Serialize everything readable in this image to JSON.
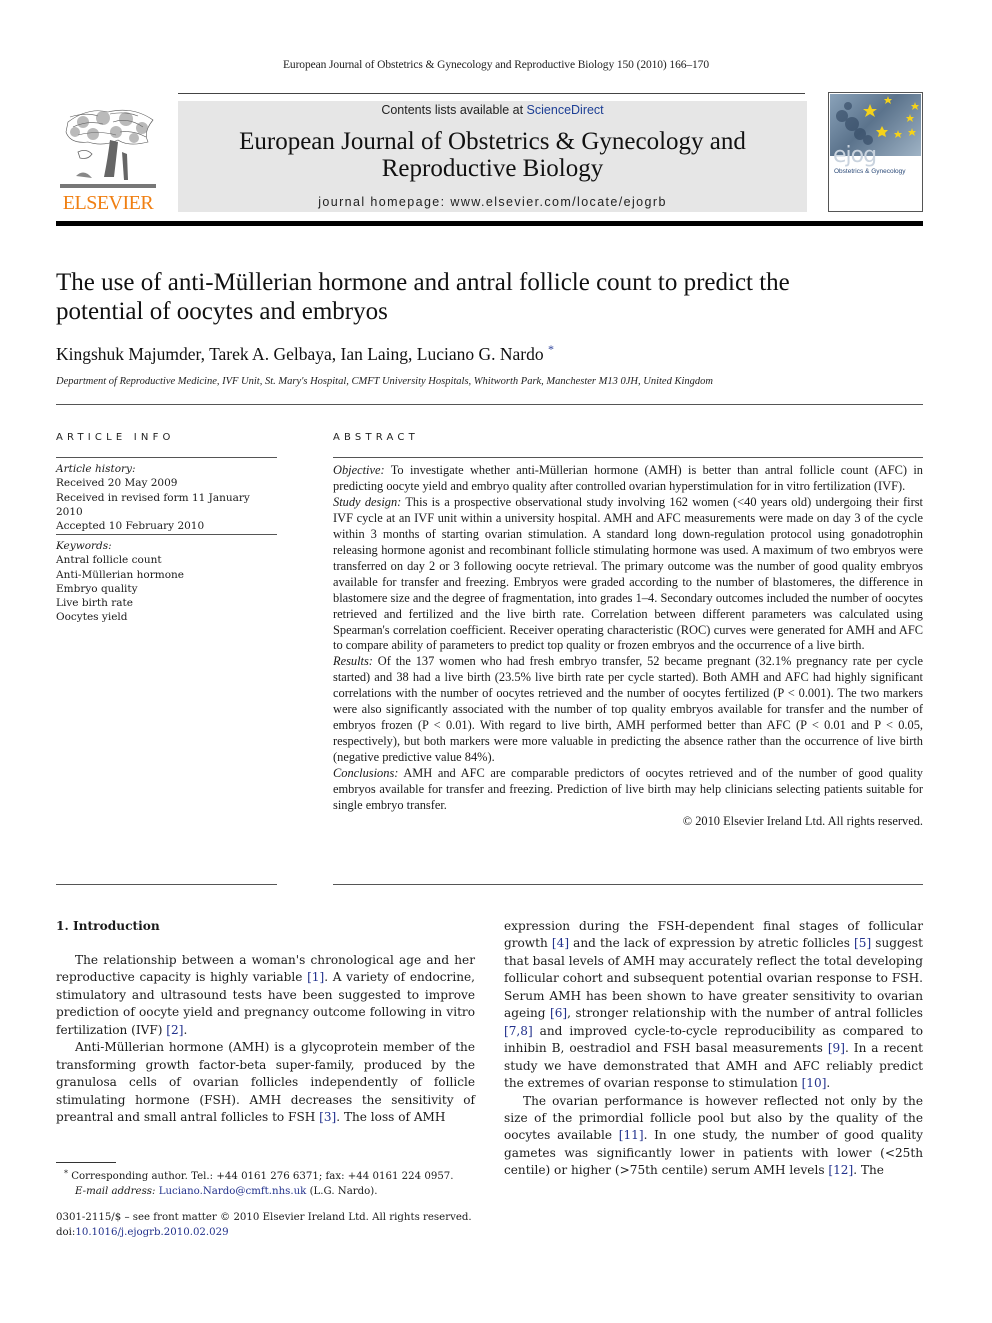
{
  "running_head": "European Journal of Obstetrics & Gynecology and Reproductive Biology 150 (2010) 166–170",
  "masthead": {
    "publisher_logo": "ELSEVIER",
    "contents_prefix": "Contents lists available at ",
    "contents_link": "ScienceDirect",
    "journal_title_line1": "European Journal of Obstetrics & Gynecology and",
    "journal_title_line2": "Reproductive Biology",
    "homepage": "journal homepage: www.elsevier.com/locate/ejogrb",
    "cover_logo": "ejog",
    "cover_subtitle": "Obstetrics & Gynecology",
    "colors": {
      "elsevier_orange": "#f07f12",
      "link_blue": "#1d3f95",
      "band_gray": "#e6e6e6"
    }
  },
  "article": {
    "title_line1": "The use of anti-Müllerian hormone and antral follicle count to predict the",
    "title_line2": "potential of oocytes and embryos",
    "authors": "Kingshuk Majumder, Tarek A. Gelbaya, Ian Laing, Luciano G. Nardo",
    "author_mark": "*",
    "affiliation": "Department of Reproductive Medicine, IVF Unit, St. Mary's Hospital, CMFT University Hospitals, Whitworth Park, Manchester M13 0JH, United Kingdom"
  },
  "article_info": {
    "heading": "ARTICLE INFO",
    "history_label": "Article history:",
    "history": [
      "Received 20 May 2009",
      "Received in revised form 11 January 2010",
      "Accepted 10 February 2010"
    ],
    "keywords_label": "Keywords:",
    "keywords": [
      "Antral follicle count",
      "Anti-Müllerian hormone",
      "Embryo quality",
      "Live birth rate",
      "Oocytes yield"
    ]
  },
  "abstract": {
    "heading": "ABSTRACT",
    "sections": [
      {
        "label": "Objective:",
        "text": " To investigate whether anti-Müllerian hormone (AMH) is better than antral follicle count (AFC) in predicting oocyte yield and embryo quality after controlled ovarian hyperstimulation for in vitro fertilization (IVF)."
      },
      {
        "label": "Study design:",
        "text": "  This is a prospective observational study involving 162 women (<40 years old) undergoing their first IVF cycle at an IVF unit within a university hospital. AMH and AFC measurements were made on day 3 of the cycle within 3 months of starting ovarian stimulation. A standard long down-regulation protocol using gonadotrophin releasing hormone agonist and recombinant follicle stimulating hormone was used. A maximum of two embryos were transferred on day 2 or 3 following oocyte retrieval. The primary outcome was the number of good quality embryos available for transfer and freezing. Embryos were graded according to the number of blastomeres, the difference in blastomere size and the degree of fragmentation, into grades 1–4. Secondary outcomes included the number of oocytes retrieved and fertilized and the live birth rate. Correlation between different parameters was calculated using Spearman's correlation coefficient. Receiver operating characteristic (ROC) curves were generated for AMH and AFC to compare ability of parameters to predict top quality or frozen embryos and the occurrence of a live birth."
      },
      {
        "label": "Results:",
        "text": "  Of the 137 women who had fresh embryo transfer, 52 became pregnant (32.1% pregnancy rate per cycle started) and 38 had a live birth (23.5% live birth rate per cycle started). Both AMH and AFC had highly significant correlations with the number of oocytes retrieved and the number of oocytes fertilized (P < 0.001). The two markers were also significantly associated with the number of top quality embryos available for transfer and the number of embryos frozen (P < 0.01). With regard to live birth, AMH performed better than AFC (P < 0.01 and P < 0.05, respectively), but both markers were more valuable in predicting the absence rather than the occurrence of live birth (negative predictive value 84%)."
      },
      {
        "label": "Conclusions:",
        "text": "  AMH and AFC are comparable predictors of oocytes retrieved and of the number of good quality embryos available for transfer and freezing. Prediction of live birth may help clinicians selecting patients suitable for single embryo transfer."
      }
    ],
    "copyright": "© 2010 Elsevier Ireland Ltd. All rights reserved."
  },
  "body": {
    "section_heading": "1.  Introduction",
    "left_paragraphs": [
      [
        {
          "t": "The relationship between a woman's chronological age and her reproductive capacity is highly variable "
        },
        {
          "ref": "[1]"
        },
        {
          "t": ". A variety of endocrine, stimulatory and ultrasound tests have been suggested to improve prediction of oocyte yield and pregnancy outcome following in vitro fertilization (IVF) "
        },
        {
          "ref": "[2]"
        },
        {
          "t": "."
        }
      ],
      [
        {
          "t": "Anti-Müllerian hormone (AMH) is a glycoprotein member of the transforming growth factor-beta super-family, produced by the granulosa cells of ovarian follicles independently of follicle stimulating hormone (FSH). AMH decreases the sensitivity of preantral and small antral follicles to FSH "
        },
        {
          "ref": "[3]"
        },
        {
          "t": ". The loss of AMH"
        }
      ]
    ],
    "right_paragraphs": [
      [
        {
          "t": "expression during the FSH-dependent final stages of follicular growth "
        },
        {
          "ref": "[4]"
        },
        {
          "t": " and the lack of expression by atretic follicles "
        },
        {
          "ref": "[5]"
        },
        {
          "t": " suggest that basal levels of AMH may accurately reflect the total developing follicular cohort and subsequent potential ovarian response to FSH. Serum AMH has been shown to have greater sensitivity to ovarian ageing "
        },
        {
          "ref": "[6]"
        },
        {
          "t": ", stronger relationship with the number of antral follicles "
        },
        {
          "ref": "[7,8]"
        },
        {
          "t": " and improved cycle-to-cycle reproducibility as compared to inhibin B, oestradiol and FSH basal measurements "
        },
        {
          "ref": "[9]"
        },
        {
          "t": ". In a recent study we have demonstrated that AMH and AFC reliably predict the extremes of ovarian response to stimulation "
        },
        {
          "ref": "[10]"
        },
        {
          "t": "."
        }
      ],
      [
        {
          "t": "The ovarian performance is however reflected not only by the size of the primordial follicle pool but also by the quality of the oocytes available "
        },
        {
          "ref": "[11]"
        },
        {
          "t": ". In one study, the number of good quality gametes was significantly lower in patients with lower (<25th centile) or higher (>75th centile) serum AMH levels "
        },
        {
          "ref": "[12]"
        },
        {
          "t": ". The"
        }
      ]
    ]
  },
  "footnotes": {
    "mark": "*",
    "corresponding": " Corresponding author. Tel.: +44 0161 276 6371; fax: +44 0161 224 0957.",
    "email_label": "E-mail address:",
    "email": "Luciano.Nardo@cmft.nhs.uk",
    "email_suffix": " (L.G. Nardo)."
  },
  "front_matter": {
    "issn_line": "0301-2115/$ – see front matter © 2010 Elsevier Ireland Ltd. All rights reserved.",
    "doi_prefix": "doi:",
    "doi": "10.1016/j.ejogrb.2010.02.029"
  }
}
